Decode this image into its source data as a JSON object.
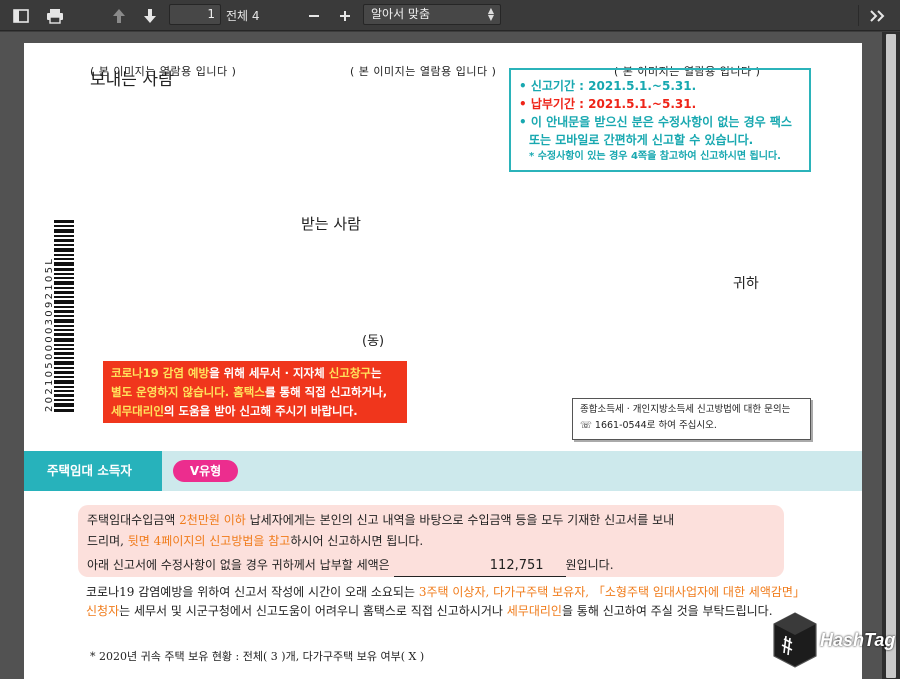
{
  "toolbar": {
    "page_number": "1",
    "page_total": "전체 4",
    "zoom_mode": "알아서 맞춤",
    "icons": [
      "sidebar-toggle-icon",
      "print-icon",
      "arrow-up-icon",
      "arrow-down-icon",
      "zoom-out-icon",
      "zoom-in-icon",
      "more-tools-icon"
    ]
  },
  "document": {
    "watermarks": [
      "( 본 이미지는 열람용 입니다 )",
      "( 본 이미지는 열람용 입니다 )",
      "( 본 이미지는 열람용 입니다 )"
    ],
    "sender_label": "보내는 사람",
    "notice": {
      "line1": "• 신고기간 : 2021.5.1.~5.31.",
      "line2": "• 납부기간 : 2021.5.1.~5.31.",
      "line3": "• 이 안내문을 받으신 분은 수정사항이 없는 경우 팩스",
      "line4": "또는 모바일로 간편하게 신고할 수 있습니다.",
      "line5": "* 수정사항이 있는 경우 4쪽을 참고하여 신고하시면 됩니다."
    },
    "receiver_label": "받는 사람",
    "honorific": "귀하",
    "dong": "(동)",
    "barcode_number": "20210500003092105L",
    "covid_notice": {
      "line1_a": "코로나19 감염 예방",
      "line1_b": "을 위해 세무서 · 지자체 ",
      "line1_c": "신고창구",
      "line1_d": "는",
      "line2_a": "별도 운영하지 않습니다. ",
      "line2_b": "홈택스",
      "line2_c": "를 통해 직접 신고하거나,",
      "line3_a": "세무대리인",
      "line3_b": "의 도움을 받아 신고해 주시기 바랍니다."
    },
    "inquiry": {
      "line1": "종합소득세 · 개인지방소득세 신고방법에 대한 문의는",
      "line2": "☏ 1661-0544로 하여 주십시오."
    },
    "section_tab": "주택임대 소득자",
    "type_badge": "V유형",
    "pink_box": {
      "p1_a": "주택임대수입금액 ",
      "p1_b": "2천만원 이하",
      "p1_c": " 납세자에게는 본인의 신고 내역을 바탕으로 수입금액 등을 모두 기재한 신고서를 보내",
      "p2_a": "드리며, ",
      "p2_b": "뒷면 4페이지의 신고방법을 참고",
      "p2_c": "하시어 신고하시면 됩니다.",
      "p3_a": "아래 신고서에 수정사항이 없을 경우 귀하께서 납부할 세액은",
      "amount": "112,751",
      "p3_b": "원입니다."
    },
    "body": {
      "a": "코로나19 감염예방을 위하여 신고서 작성에 시간이 오래 소요되는 ",
      "b": "3주택 이상자, 다가구주택 보유자, 「소형주택 임대사업자에 대한 세액감면」 신청자",
      "c": "는 세무서 및 시군구청에서 신고도움이 어려우니 홈택스로 직접 신고하시거나 ",
      "d": "세무대리인",
      "e": "을 통해 신고하여 주실 것을 부탁드립니다."
    },
    "footnote": "* 2020년 귀속 주택 보유 현황 : 전체( 3 )개, 다가구주택 보유 여부( X )",
    "logo_text": "HashTag"
  },
  "colors": {
    "toolbar_bg": "#3a3a3a",
    "teal": "#27b2bb",
    "red": "#ee2418",
    "orange": "#f07b1a",
    "magenta": "#ec2d8e",
    "pink_bg": "#fce0dc"
  }
}
